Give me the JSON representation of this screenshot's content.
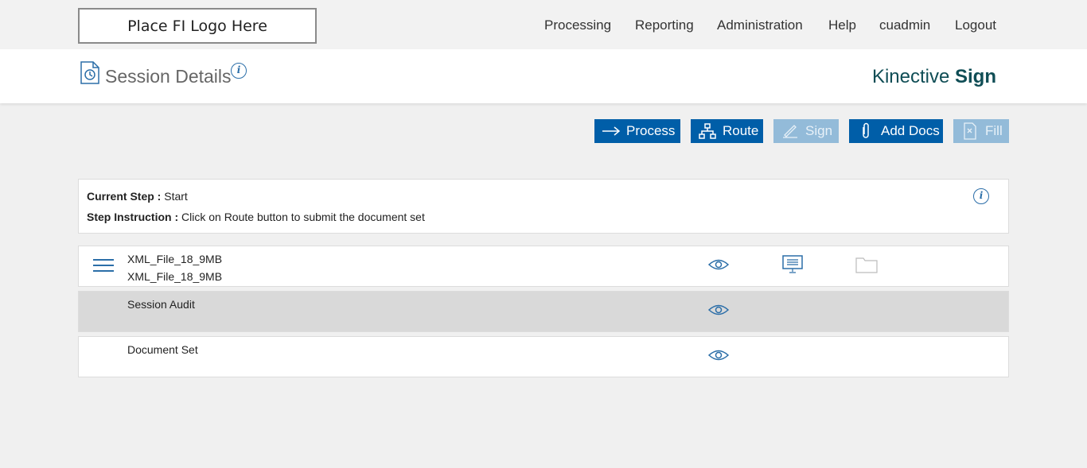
{
  "top_nav": {
    "logo_text": "Place FI Logo Here",
    "items": [
      "Processing",
      "Reporting",
      "Administration",
      "Help",
      "cuadmin",
      "Logout"
    ]
  },
  "header": {
    "title": "Session Details",
    "brand_regular": "Kinective ",
    "brand_bold": "Sign",
    "info_glyph": "i"
  },
  "toolbar": {
    "buttons": [
      {
        "label": "Process",
        "icon": "arrow-right-icon",
        "enabled": true
      },
      {
        "label": "Route",
        "icon": "hierarchy-icon",
        "enabled": true
      },
      {
        "label": "Sign",
        "icon": "pen-icon",
        "enabled": false
      },
      {
        "label": "Add Docs",
        "icon": "paperclip-icon",
        "enabled": true
      },
      {
        "label": "Fill",
        "icon": "form-fill-icon",
        "enabled": false
      }
    ]
  },
  "step": {
    "current_label": "Current Step :",
    "current_value": " Start",
    "instruction_label": "Step Instruction :",
    "instruction_value": " Click on Route button to submit the document set"
  },
  "rows": [
    {
      "line1": "XML_File_18_9MB",
      "line2": "XML_File_18_9MB"
    },
    {
      "line1": "Session Audit"
    },
    {
      "line1": "Document Set"
    }
  ],
  "colors": {
    "primary": "#005ea8",
    "disabled": "#93bbd9",
    "brand": "#0f4d55",
    "icon_blue": "#2b6ea8"
  }
}
